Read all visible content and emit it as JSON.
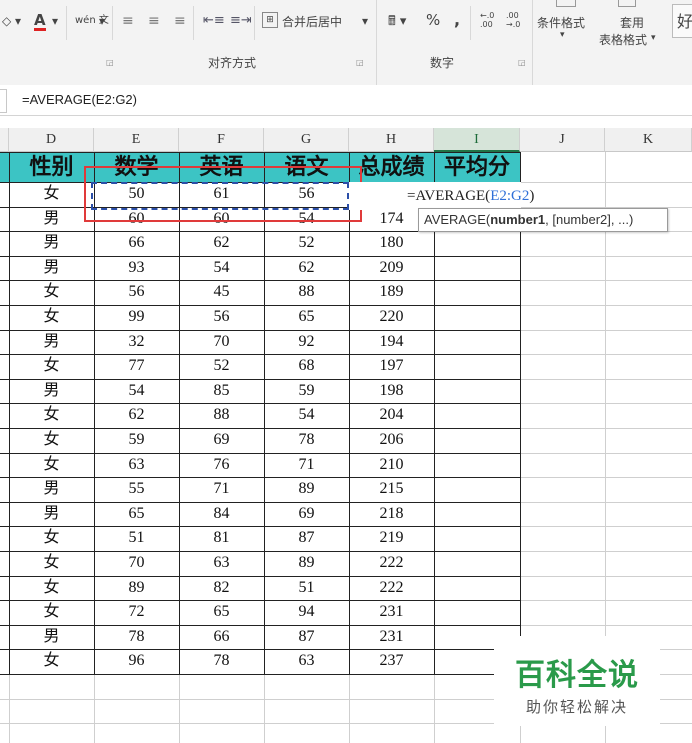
{
  "ribbon": {
    "font_color_label": "A",
    "phonetic_label": "wén 文",
    "merge_center_label": "合并后居中",
    "percent_label": "%",
    "comma_label": ",",
    "increase_decimal_label": "←.0 .00",
    "decrease_decimal_label": ".00 →.0",
    "conditional_format_label": "条件格式",
    "table_format_label_1": "套用",
    "table_format_label_2": "表格格式",
    "style_good_label": "好",
    "group_alignment": "对齐方式",
    "group_number": "数字"
  },
  "formula_bar": {
    "formula": "=AVERAGE(E2:G2)"
  },
  "columns": [
    "D",
    "E",
    "F",
    "G",
    "H",
    "I",
    "J",
    "K"
  ],
  "active_column": "I",
  "table": {
    "headers": [
      "性别",
      "数学",
      "英语",
      "语文",
      "总成绩",
      "平均分"
    ],
    "rows": [
      [
        "女",
        "50",
        "61",
        "56",
        ""
      ],
      [
        "男",
        "60",
        "60",
        "54",
        "174"
      ],
      [
        "男",
        "66",
        "62",
        "52",
        "180"
      ],
      [
        "男",
        "93",
        "54",
        "62",
        "209"
      ],
      [
        "女",
        "56",
        "45",
        "88",
        "189"
      ],
      [
        "女",
        "99",
        "56",
        "65",
        "220"
      ],
      [
        "男",
        "32",
        "70",
        "92",
        "194"
      ],
      [
        "女",
        "77",
        "52",
        "68",
        "197"
      ],
      [
        "男",
        "54",
        "85",
        "59",
        "198"
      ],
      [
        "女",
        "62",
        "88",
        "54",
        "204"
      ],
      [
        "女",
        "59",
        "69",
        "78",
        "206"
      ],
      [
        "女",
        "63",
        "76",
        "71",
        "210"
      ],
      [
        "男",
        "55",
        "71",
        "89",
        "215"
      ],
      [
        "男",
        "65",
        "84",
        "69",
        "218"
      ],
      [
        "女",
        "51",
        "81",
        "87",
        "219"
      ],
      [
        "女",
        "70",
        "63",
        "89",
        "222"
      ],
      [
        "女",
        "89",
        "82",
        "51",
        "222"
      ],
      [
        "女",
        "72",
        "65",
        "94",
        "231"
      ],
      [
        "男",
        "78",
        "66",
        "87",
        "231"
      ],
      [
        "女",
        "96",
        "78",
        "63",
        "237"
      ]
    ]
  },
  "editing": {
    "prefix": "=AVERAGE(",
    "ref_start": "E2",
    "ref_sep": ":",
    "ref_end": "G2",
    "suffix": ")"
  },
  "tooltip": {
    "func": "AVERAGE(",
    "arg1": "number1",
    "rest": ", [number2], ...)"
  },
  "watermark": {
    "title": "百科全说",
    "subtitle": "助你轻松解决"
  },
  "colors": {
    "header_fill": "#3cc4c4",
    "selection_outline": "#e03a3a",
    "copy_marquee": "#2b4fa8",
    "reference_text": "#2e6fd8",
    "watermark_green": "#2a9a4a"
  }
}
